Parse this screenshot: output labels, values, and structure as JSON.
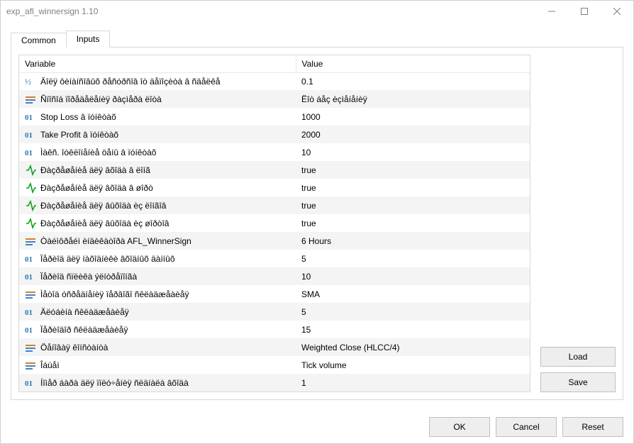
{
  "window": {
    "title": "exp_afl_winnersign 1.10"
  },
  "tabs": {
    "common": "Common",
    "inputs": "Inputs"
  },
  "table": {
    "headers": {
      "variable": "Variable",
      "value": "Value"
    },
    "rows": [
      {
        "type": "double",
        "variable": "Äîëÿ ôèíàíñîâûõ ðåñóðñîâ îò äåïîçèòà â ñäåëêå",
        "value": "0.1"
      },
      {
        "type": "string",
        "variable": "Ñïîñîá ïîðåäåëåíèÿ ðàçìåðà ëîòà",
        "value": "Ëîò áåç èçìåíåíèÿ"
      },
      {
        "type": "int",
        "variable": "Stop Loss â ïóíêòàõ",
        "value": "1000"
      },
      {
        "type": "int",
        "variable": "Take Profit â ïóíêòàõ",
        "value": "2000"
      },
      {
        "type": "int",
        "variable": "Ìàêñ. îòêëîíåíèå öåíû â ïóíêòàõ",
        "value": "10"
      },
      {
        "type": "bool",
        "variable": "Ðàçðåøåíèå äëÿ âõîäà â ëîíã",
        "value": "true"
      },
      {
        "type": "bool",
        "variable": "Ðàçðåøåíèå äëÿ âõîäà â øîðò",
        "value": "true"
      },
      {
        "type": "bool",
        "variable": "Ðàçðåøåíèå äëÿ âûõîäà èç ëîíãîâ",
        "value": "true"
      },
      {
        "type": "bool",
        "variable": "Ðàçðåøåíèå äëÿ âûõîäà èç øîðòîâ",
        "value": "true"
      },
      {
        "type": "string",
        "variable": "Òàéìôðåéì èíäèêàòîðà AFL_WinnerSign",
        "value": "6 Hours"
      },
      {
        "type": "int",
        "variable": "Ïåðèîä äëÿ íàõîäíèêè âõîäíûõ äàííûõ",
        "value": "5"
      },
      {
        "type": "int",
        "variable": "Ïåðèîä ñïëèêà ýëíòðåïîíãà",
        "value": "10"
      },
      {
        "type": "string",
        "variable": "Ìåòîä óñðåäíåíèÿ ïåðâîãî ñêëàäæåàèåÿ",
        "value": "SMA"
      },
      {
        "type": "int",
        "variable": "Äëóáèíà  ñêëàäæåàèåÿ",
        "value": "5"
      },
      {
        "type": "int",
        "variable": "Ïåðèîäîð ñêëàäæåàèåÿ",
        "value": "15"
      },
      {
        "type": "string",
        "variable": "Öåíîâàÿ êîíñòàíòà",
        "value": "Weighted Close (HLCC/4)"
      },
      {
        "type": "string",
        "variable": "Îáúåì",
        "value": "Tick volume"
      },
      {
        "type": "int",
        "variable": "Íîìåð áàðà äëÿ ïïëó÷åíèÿ ñëäíàëà âõîäà",
        "value": "1"
      }
    ]
  },
  "buttons": {
    "load": "Load",
    "save": "Save",
    "ok": "OK",
    "cancel": "Cancel",
    "reset": "Reset"
  }
}
